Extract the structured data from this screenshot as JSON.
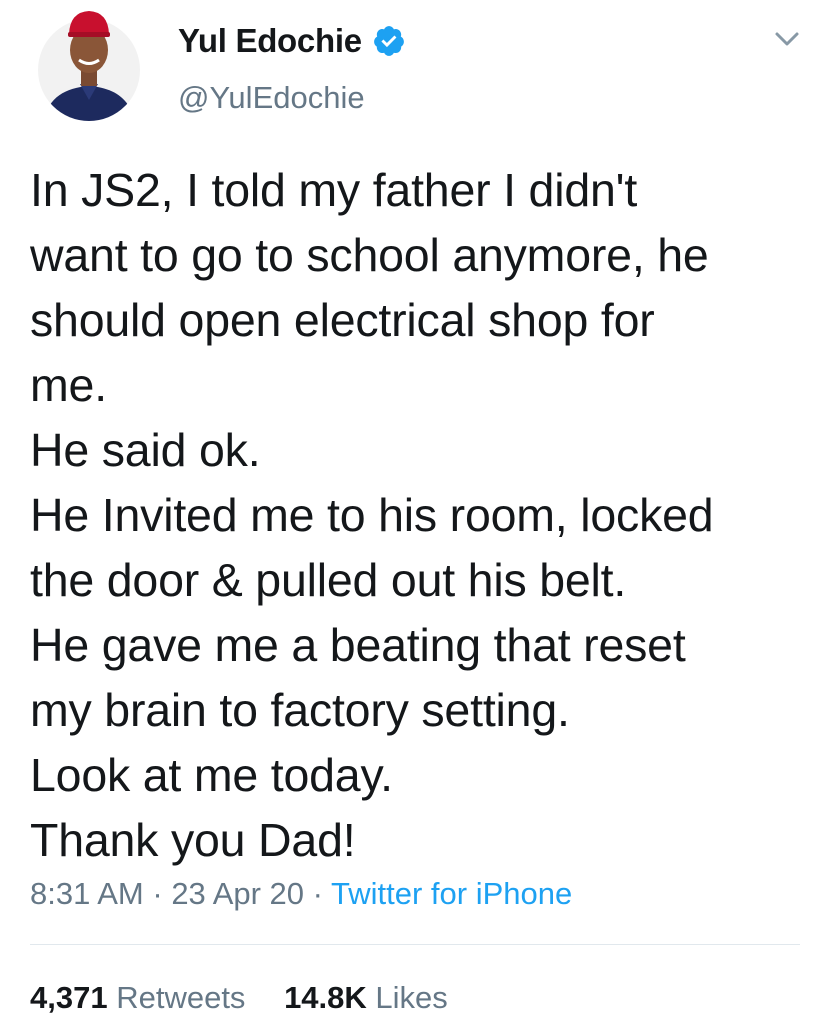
{
  "user": {
    "display_name": "Yul Edochie",
    "handle": "@YulEdochie",
    "verified_icon": "verified-badge-icon",
    "verified_color": "#1da1f2"
  },
  "menu": {
    "icon": "chevron-down-icon"
  },
  "tweet": {
    "lines": [
      "In JS2, I told my father I didn't",
      "want to go to school anymore, he",
      "should open electrical shop for",
      "me.",
      "He said ok.",
      "He Invited me to his room, locked",
      "the door & pulled out his belt.",
      "He gave me a beating that reset",
      "my brain to factory setting.",
      "Look at me today.",
      "Thank you Dad!"
    ]
  },
  "meta": {
    "time": "8:31 AM",
    "separator": " · ",
    "date": "23 Apr 20",
    "source": "Twitter for iPhone"
  },
  "stats": {
    "retweets_count": "4,371",
    "retweets_label": "Retweets",
    "likes_count": "14.8K",
    "likes_label": "Likes"
  },
  "colors": {
    "text": "#14171a",
    "secondary": "#657786",
    "link": "#1da1f2",
    "divider": "#e1e8ed"
  }
}
